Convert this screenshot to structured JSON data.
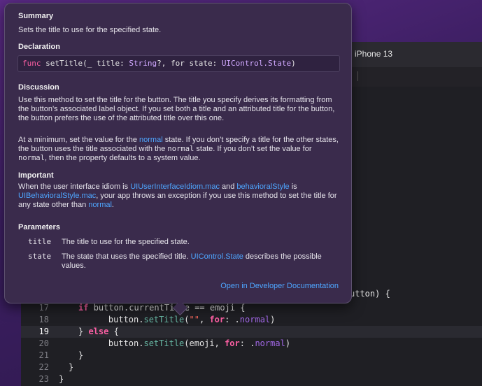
{
  "xcode": {
    "device_label": "iPhone 13",
    "partial_code": "utton) {",
    "code_lines": [
      {
        "num": "17",
        "current": false,
        "tokens": [
          [
            "kw",
            "if "
          ],
          [
            "pl",
            "button.curr"
          ],
          [
            "pl",
            "entTitle == emoji {"
          ]
        ]
      },
      {
        "num": "18",
        "current": false,
        "tokens": [
          [
            "pl",
            "    button."
          ],
          [
            "fn",
            "setTitle"
          ],
          [
            "pl",
            "("
          ],
          [
            "str",
            "\"\""
          ],
          [
            "pl",
            ", "
          ],
          [
            "kw",
            "for"
          ],
          [
            "pl",
            ": ."
          ],
          [
            "ident",
            "normal"
          ],
          [
            "pl",
            ")"
          ]
        ]
      },
      {
        "num": "19",
        "current": true,
        "tokens": [
          [
            "pl",
            "} "
          ],
          [
            "kw",
            "else"
          ],
          [
            "pl",
            " {"
          ]
        ]
      },
      {
        "num": "20",
        "current": false,
        "tokens": [
          [
            "pl",
            "    button."
          ],
          [
            "fn",
            "setTitle"
          ],
          [
            "pl",
            "(emoji, "
          ],
          [
            "kw",
            "for"
          ],
          [
            "pl",
            ": ."
          ],
          [
            "ident",
            "normal"
          ],
          [
            "pl",
            ")"
          ]
        ]
      },
      {
        "num": "21",
        "current": false,
        "tokens": [
          [
            "pl",
            "}"
          ]
        ]
      },
      {
        "num": "22",
        "current": false,
        "tokens": [
          [
            "pl",
            "}"
          ]
        ]
      },
      {
        "num": "23",
        "current": false,
        "tokens": [
          [
            "pl",
            "}"
          ]
        ]
      }
    ]
  },
  "quick_help": {
    "summary_heading": "Summary",
    "summary_text": "Sets the title to use for the specified state.",
    "declaration_heading": "Declaration",
    "declaration": {
      "kw": "func",
      "name": " setTitle(_ title: ",
      "type1": "String",
      "mid": "?, for state: ",
      "type2": "UIControl.State",
      "end": ")"
    },
    "discussion_heading": "Discussion",
    "discussion_p1": "Use this method to set the title for the button. The title you specify derives its formatting from the button’s associated label object. If you set both a title and an attributed title for the button, the button prefers the use of the attributed title over this one.",
    "discussion_p2": {
      "a": "At a minimum, set the value for the ",
      "link1": "normal",
      "b": " state. If you don’t specify a title for the other states, the button uses the title associated with the ",
      "code1": "normal",
      "c": " state. If you don’t set the value for ",
      "code2": "normal",
      "d": ", then the property defaults to a system value."
    },
    "important_heading": "Important",
    "important": {
      "a": "When the user interface idiom is ",
      "link1": "UIUserInterfaceIdiom.mac",
      "b": " and ",
      "link2": "behavioralStyle",
      "c": " is ",
      "link3": "UIBehavioralStyle.mac",
      "d": ", your app throws an exception if you use this method to set the title for any state other than ",
      "link4": "normal",
      "e": "."
    },
    "parameters_heading": "Parameters",
    "params": [
      {
        "name": "title",
        "desc_a": "The title to use for the specified state.",
        "link": "",
        "desc_b": ""
      },
      {
        "name": "state",
        "desc_a": "The state that uses the specified title. ",
        "link": "UIControl.State",
        "desc_b": " describes the possible values."
      }
    ],
    "open_docs": "Open in Developer Documentation"
  }
}
